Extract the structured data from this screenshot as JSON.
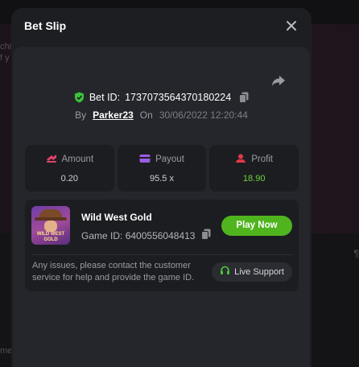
{
  "background": {
    "line1": "chi",
    "line2": "f y",
    "line3": "me",
    "line4": "¶"
  },
  "modal": {
    "title": "Bet Slip"
  },
  "bet": {
    "id_label": "Bet ID:",
    "id_value": "1737073564370180224",
    "by_label": "By",
    "username": "Parker23",
    "on_label": "On",
    "date": "30/06/2022 12:20:44"
  },
  "stats": {
    "amount_label": "Amount",
    "amount_value": "0.20",
    "payout_label": "Payout",
    "payout_value": "95.5 x",
    "profit_label": "Profit",
    "profit_value": "18.90"
  },
  "game": {
    "name": "Wild West Gold",
    "id_label": "Game ID:",
    "id_value": "6400556048413",
    "play_label": "Play Now",
    "thumb_text": "WILD WEST GOLD"
  },
  "support": {
    "text": "Any issues, please contact the customer service for help and provide the game ID.",
    "button_label": "Live Support"
  },
  "colors": {
    "accent_green": "#50b41f",
    "profit_green": "#6bd43a",
    "icon_pink": "#e0436a",
    "icon_purple": "#9b5de5",
    "icon_red": "#e23a4b"
  }
}
